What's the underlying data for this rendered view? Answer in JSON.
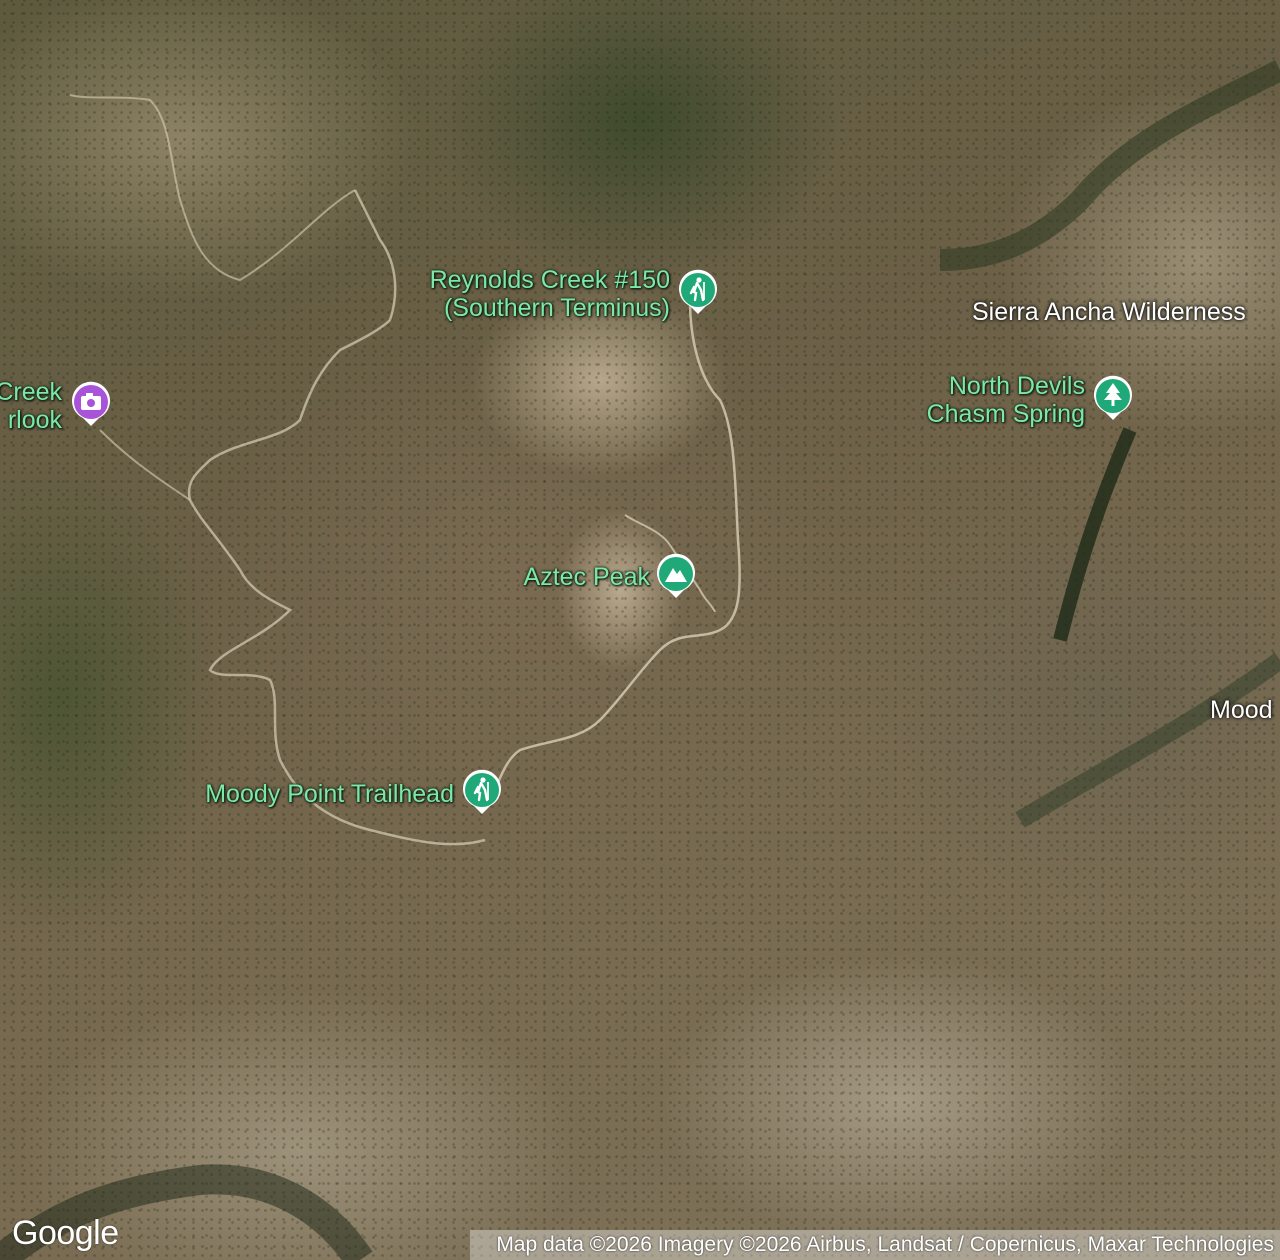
{
  "map": {
    "pois": [
      {
        "id": "reynolds",
        "label": "Reynolds Creek #150\n(Southern Terminus)",
        "icon": "hiker-icon",
        "color": "#1fa979"
      },
      {
        "id": "aztec",
        "label": "Aztec Peak",
        "icon": "mountain-icon",
        "color": "#1fa979"
      },
      {
        "id": "moody",
        "label": "Moody Point Trailhead",
        "icon": "hiker-icon",
        "color": "#1fa979"
      },
      {
        "id": "northdevils",
        "label": "North Devils\nChasm Spring",
        "icon": "tree-icon",
        "color": "#1fa979"
      },
      {
        "id": "overlook",
        "label": "Creek\nrlook",
        "icon": "camera-icon",
        "color": "#a853d8"
      }
    ],
    "regions": [
      {
        "id": "sierra",
        "label": "Sierra Ancha Wilderness"
      },
      {
        "id": "mood",
        "label": "Mood"
      }
    ],
    "logo": "Google",
    "attribution": "Map data ©2026 Imagery ©2026 Airbus, Landsat / Copernicus, Maxar Technologies"
  }
}
